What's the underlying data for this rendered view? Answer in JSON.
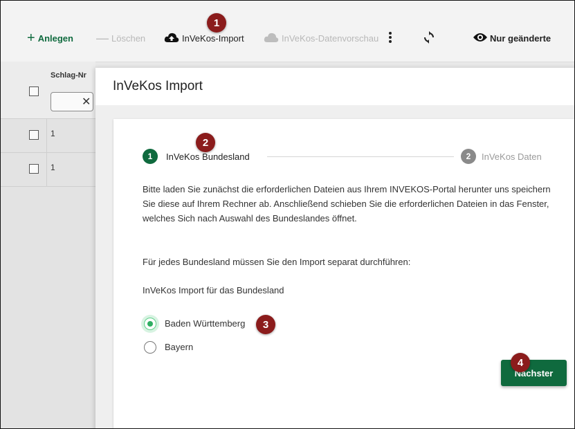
{
  "toolbar": {
    "create_label": "Anlegen",
    "delete_label": "Löschen",
    "import_label": "InVeKos-Import",
    "preview_label": "InVeKos-Datenvorschau",
    "changed_label": "Nur geänderte"
  },
  "grid": {
    "column_header": "Schlag-Nr",
    "rows": [
      "1",
      "1"
    ]
  },
  "dialog": {
    "title": "InVeKos Import",
    "steps": [
      {
        "number": "1",
        "label": "InVeKos Bundesland",
        "active": true
      },
      {
        "number": "2",
        "label": "InVeKos Daten",
        "active": false
      }
    ],
    "instructions": "Bitte laden Sie zunächst die erforderlichen Dateien aus Ihrem INVEKOS-Portal herunter uns speichern Sie diese auf Ihrem Rechner ab. Anschließend schieben Sie die erforderlichen Dateien in das Fenster, welches Sich nach Auswahl des Bundeslandes öffnet.",
    "separate_note": "Für jedes Bundesland müssen Sie den Import separat durchführen:",
    "select_label": "InVeKos Import für das Bundesland",
    "options": [
      {
        "label": "Baden Württemberg",
        "selected": true
      },
      {
        "label": "Bayern",
        "selected": false
      }
    ],
    "next_label": "Nächster"
  },
  "markers": [
    "1",
    "2",
    "3",
    "4"
  ],
  "colors": {
    "accent": "#0f6a3e",
    "marker": "#8b1c1c",
    "radio_selected": "#2fae62",
    "step_inactive": "#8a8a8a"
  },
  "icons": {
    "create": "plus-icon",
    "delete": "minus-icon",
    "import": "cloud-upload-icon",
    "preview": "cloud-icon",
    "more": "more-vert-icon",
    "refresh": "refresh-icon",
    "changed": "eye-icon",
    "clear": "close-icon"
  }
}
